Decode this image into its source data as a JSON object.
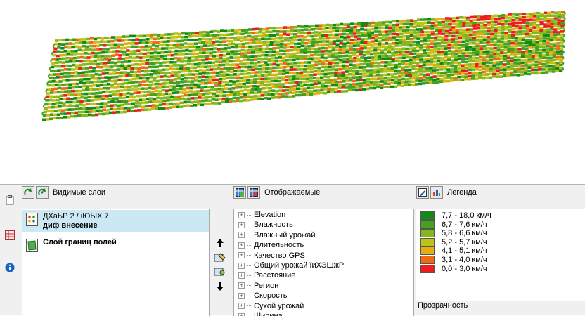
{
  "layers_panel": {
    "title": "Видимые слои",
    "layers": [
      {
        "line1": "ДХаЬР 2 / iЮЫХ 7",
        "line2": "диф внесение",
        "selected": true
      },
      {
        "line1": "Слой границ полей",
        "line2": "",
        "selected": false
      }
    ]
  },
  "fields_panel": {
    "title": "Отображаемые",
    "items": [
      "Elevation",
      "Влажность",
      "Влажный урожай",
      "Длительность",
      "Качество GPS",
      "Общий урожай ïиХЭШжР",
      "Расстояние",
      "Регион",
      "Скорость",
      "Сухой урожай",
      "Ширина"
    ]
  },
  "legend_panel": {
    "title": "Легенда",
    "entries": [
      {
        "label": "7,7 - 18,0 км/ч",
        "color": "#138a13"
      },
      {
        "label": "6,7 - 7,6 км/ч",
        "color": "#43a020"
      },
      {
        "label": "5,8 - 6,6 км/ч",
        "color": "#84b61e"
      },
      {
        "label": "5,2 - 5,7 км/ч",
        "color": "#bcc41c"
      },
      {
        "label": "4,1 - 5,1 км/ч",
        "color": "#e3ae0f"
      },
      {
        "label": "3,1 - 4,0 км/ч",
        "color": "#ee6a15"
      },
      {
        "label": "0,0 - 3,0 км/ч",
        "color": "#ee1d1d"
      }
    ],
    "transparency_label": "Прозрачность"
  },
  "map": {
    "track_colors": [
      "#138a13",
      "#43a020",
      "#84b61e",
      "#bcc41c",
      "#e3ae0f",
      "#ee6a15",
      "#ee1d1d"
    ]
  }
}
